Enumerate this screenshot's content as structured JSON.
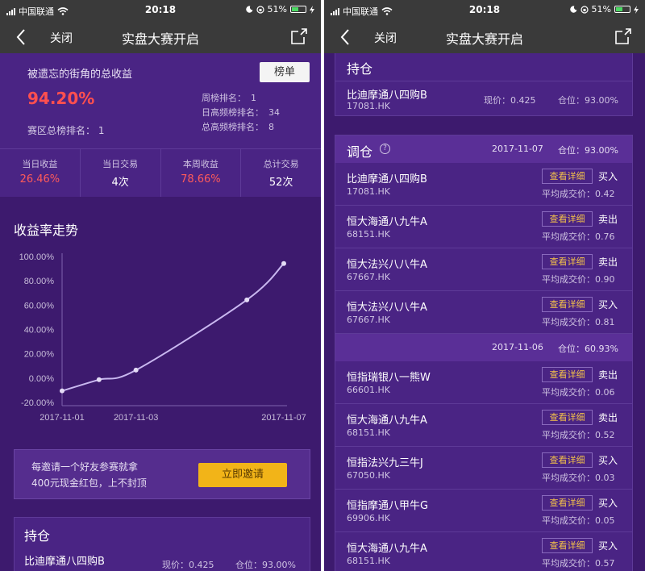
{
  "status_bar": {
    "carrier": "中国联通",
    "time": "20:18",
    "battery": "51%",
    "battery_level": 0.51,
    "icons": [
      "signal-icon",
      "wifi-icon",
      "moon-icon",
      "orientation-lock-icon",
      "battery-icon",
      "charging-icon"
    ]
  },
  "nav": {
    "close_label": "关闭",
    "title": "实盘大赛开启",
    "icons": [
      "back-icon",
      "share-icon"
    ]
  },
  "profile": {
    "name": "被遗忘的街角的总收益",
    "rank_button": "榜单",
    "total_return": "94.20%",
    "region_rank_label": "赛区总榜排名：",
    "region_rank_value": "1",
    "ranks": [
      {
        "label": "周榜排名：",
        "value": "1"
      },
      {
        "label": "日高频榜排名：",
        "value": "34"
      },
      {
        "label": "总高频榜排名：",
        "value": "8"
      }
    ]
  },
  "stats": [
    {
      "label": "当日收益",
      "value": "26.46%",
      "highlight": true
    },
    {
      "label": "当日交易",
      "value": "4次",
      "highlight": false
    },
    {
      "label": "本周收益",
      "value": "78.66%",
      "highlight": true
    },
    {
      "label": "总计交易",
      "value": "52次",
      "highlight": false
    }
  ],
  "chart_section": {
    "title": "收益率走势"
  },
  "chart_data": {
    "type": "line",
    "title": "",
    "xlabel": "",
    "ylabel": "",
    "x_ticks": [
      "2017-11-01",
      "2017-11-03",
      "2017-11-07"
    ],
    "y_ticks": [
      "100.00%",
      "80.00%",
      "60.00%",
      "40.00%",
      "20.00%",
      "0.00%",
      "-20.00%"
    ],
    "ylim": [
      -20,
      100
    ],
    "series": [
      {
        "x": [
          "2017-11-01",
          "2017-11-02",
          "2017-11-03",
          "2017-11-06",
          "2017-11-07"
        ],
        "values": [
          -10.5,
          -1.3,
          6.6,
          64.3,
          94.2
        ]
      }
    ],
    "line_color": "#c9b8f0",
    "grid": false
  },
  "invite": {
    "text_line1": "每邀请一个好友参赛就拿",
    "text_line2": "400元现金红包，上不封顶",
    "button": "立即邀请"
  },
  "holdings": {
    "title": "持仓",
    "items": [
      {
        "name": "比迪摩通八四购B",
        "code": "17081.HK",
        "price": "现价：0.425",
        "position": "仓位：93.00%"
      }
    ]
  },
  "adjustments": {
    "title": "调仓",
    "help_icon": "?",
    "detail_label": "查看详细",
    "groups": [
      {
        "date": "2017-11-07",
        "position": "仓位：93.00%",
        "trades": [
          {
            "name": "比迪摩通八四购B",
            "code": "17081.HK",
            "action": "买入",
            "avg": "平均成交价：0.42"
          },
          {
            "name": "恒大海通八九牛A",
            "code": "68151.HK",
            "action": "卖出",
            "avg": "平均成交价：0.76"
          },
          {
            "name": "恒大法兴八八牛A",
            "code": "67667.HK",
            "action": "卖出",
            "avg": "平均成交价：0.90"
          },
          {
            "name": "恒大法兴八八牛A",
            "code": "67667.HK",
            "action": "买入",
            "avg": "平均成交价：0.81"
          }
        ]
      },
      {
        "date": "2017-11-06",
        "position": "仓位：60.93%",
        "trades": [
          {
            "name": "恒指瑞银八一熊W",
            "code": "66601.HK",
            "action": "卖出",
            "avg": "平均成交价：0.06"
          },
          {
            "name": "恒大海通八九牛A",
            "code": "68151.HK",
            "action": "卖出",
            "avg": "平均成交价：0.52"
          },
          {
            "name": "恒指法兴九三牛J",
            "code": "67050.HK",
            "action": "买入",
            "avg": "平均成交价：0.03"
          },
          {
            "name": "恒指摩通八甲牛G",
            "code": "69906.HK",
            "action": "买入",
            "avg": "平均成交价：0.05"
          },
          {
            "name": "恒大海通八九牛A",
            "code": "68151.HK",
            "action": "买入",
            "avg": "平均成交价：0.57"
          }
        ]
      }
    ]
  },
  "colors": {
    "background": "#3d1a6e",
    "card": "#4a2484",
    "accent_red": "#ff4f4f",
    "button_yellow": "#f2b418"
  }
}
